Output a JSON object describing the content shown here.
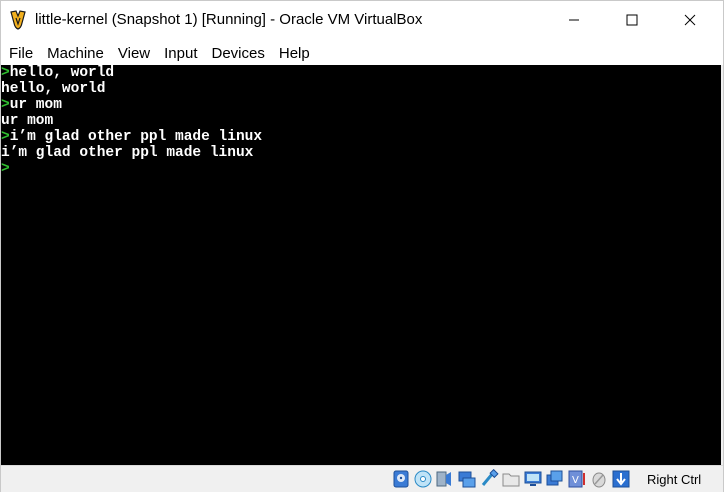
{
  "window": {
    "title": "little-kernel (Snapshot 1) [Running] - Oracle VM VirtualBox"
  },
  "menu": {
    "items": [
      "File",
      "Machine",
      "View",
      "Input",
      "Devices",
      "Help"
    ]
  },
  "console": {
    "prompt_symbol": ">",
    "lines": [
      {
        "prompt": ">",
        "text": "hello, world"
      },
      {
        "prompt": "",
        "text": "hello, world"
      },
      {
        "prompt": ">",
        "text": "ur mom"
      },
      {
        "prompt": "",
        "text": "ur mom"
      },
      {
        "prompt": ">",
        "text": "i’m glad other ppl made linux"
      },
      {
        "prompt": "",
        "text": "i’m glad other ppl made linux"
      },
      {
        "prompt": ">",
        "text": ""
      }
    ]
  },
  "statusbar": {
    "icons": [
      "hard-disk-icon",
      "optical-drive-icon",
      "audio-icon",
      "network-icon",
      "usb-icon",
      "shared-folders-icon",
      "display-icon",
      "video-capture-icon",
      "virtualization-icon",
      "mouse-integration-icon",
      "keyboard-capture-icon"
    ],
    "host_key": "Right Ctrl"
  },
  "colors": {
    "console_bg": "#000000",
    "console_text": "#ffffff",
    "prompt": "#30c030",
    "accent": "#1e6fd9"
  }
}
